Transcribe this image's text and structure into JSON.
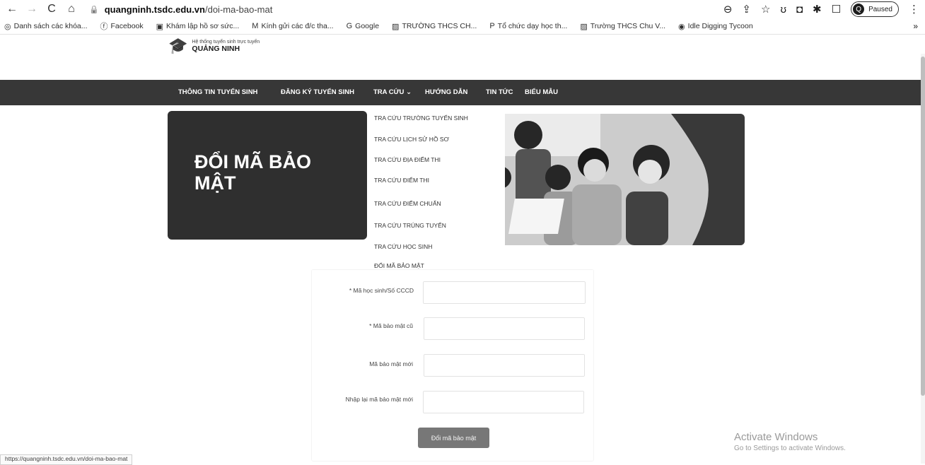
{
  "browser": {
    "url_host": "quangninh.tsdc.edu.vn",
    "url_path": "/doi-ma-bao-mat",
    "profile_status": "Paused",
    "profile_initial": "Q"
  },
  "bookmarks": [
    {
      "label": "Danh sách các khóa...",
      "icon": "course-icon"
    },
    {
      "label": "Facebook",
      "icon": "facebook-icon"
    },
    {
      "label": "Khám lập hồ sơ sức...",
      "icon": "doc-icon"
    },
    {
      "label": "Kính gửi các đ/c tha...",
      "icon": "gmail-icon"
    },
    {
      "label": "Google",
      "icon": "google-icon"
    },
    {
      "label": "TRƯỜNG THCS CH...",
      "icon": "school-icon"
    },
    {
      "label": "Tổ chức dạy học th...",
      "icon": "p-icon"
    },
    {
      "label": "Trường THCS Chu V...",
      "icon": "school-icon"
    },
    {
      "label": "Idle Digging Tycoon",
      "icon": "game-icon"
    }
  ],
  "site": {
    "logo_sub": "Hệ thống tuyển sinh trực tuyến",
    "logo_name": "QUẢNG NINH"
  },
  "nav": [
    "THÔNG TIN TUYỂN SINH",
    "ĐĂNG KÝ TUYỂN SINH",
    "TRA CỨU",
    "HƯỚNG DẪN",
    "TIN TỨC",
    "BIỂU MẪU"
  ],
  "dropdown": [
    "TRA CỨU TRƯỜNG TUYỂN SINH",
    "TRA CỨU LỊCH SỬ HỒ SƠ",
    "TRA CỨU ĐỊA ĐIỂM THI",
    "TRA CỨU ĐIỂM THI",
    "TRA CỨU ĐIỂM CHUẨN",
    "TRA CỨU TRÚNG TUYỂN",
    "TRA CỨU HỌC SINH",
    "ĐỔI MÃ BẢO MẬT"
  ],
  "banner": {
    "title": "ĐỔI MÃ BẢO MẬT"
  },
  "form": {
    "student_id_label": "* Mã học sinh/Số CCCD",
    "old_code_label": "* Mã bảo mật cũ",
    "new_code_label": "Mã bảo mật mới",
    "confirm_code_label": "Nhập lại mã bảo mật mới",
    "submit_label": "Đổi mã bảo mật"
  },
  "status_url": "https://quangninh.tsdc.edu.vn/doi-ma-bao-mat",
  "watermark": {
    "line1": "Activate Windows",
    "line2": "Go to Settings to activate Windows."
  }
}
